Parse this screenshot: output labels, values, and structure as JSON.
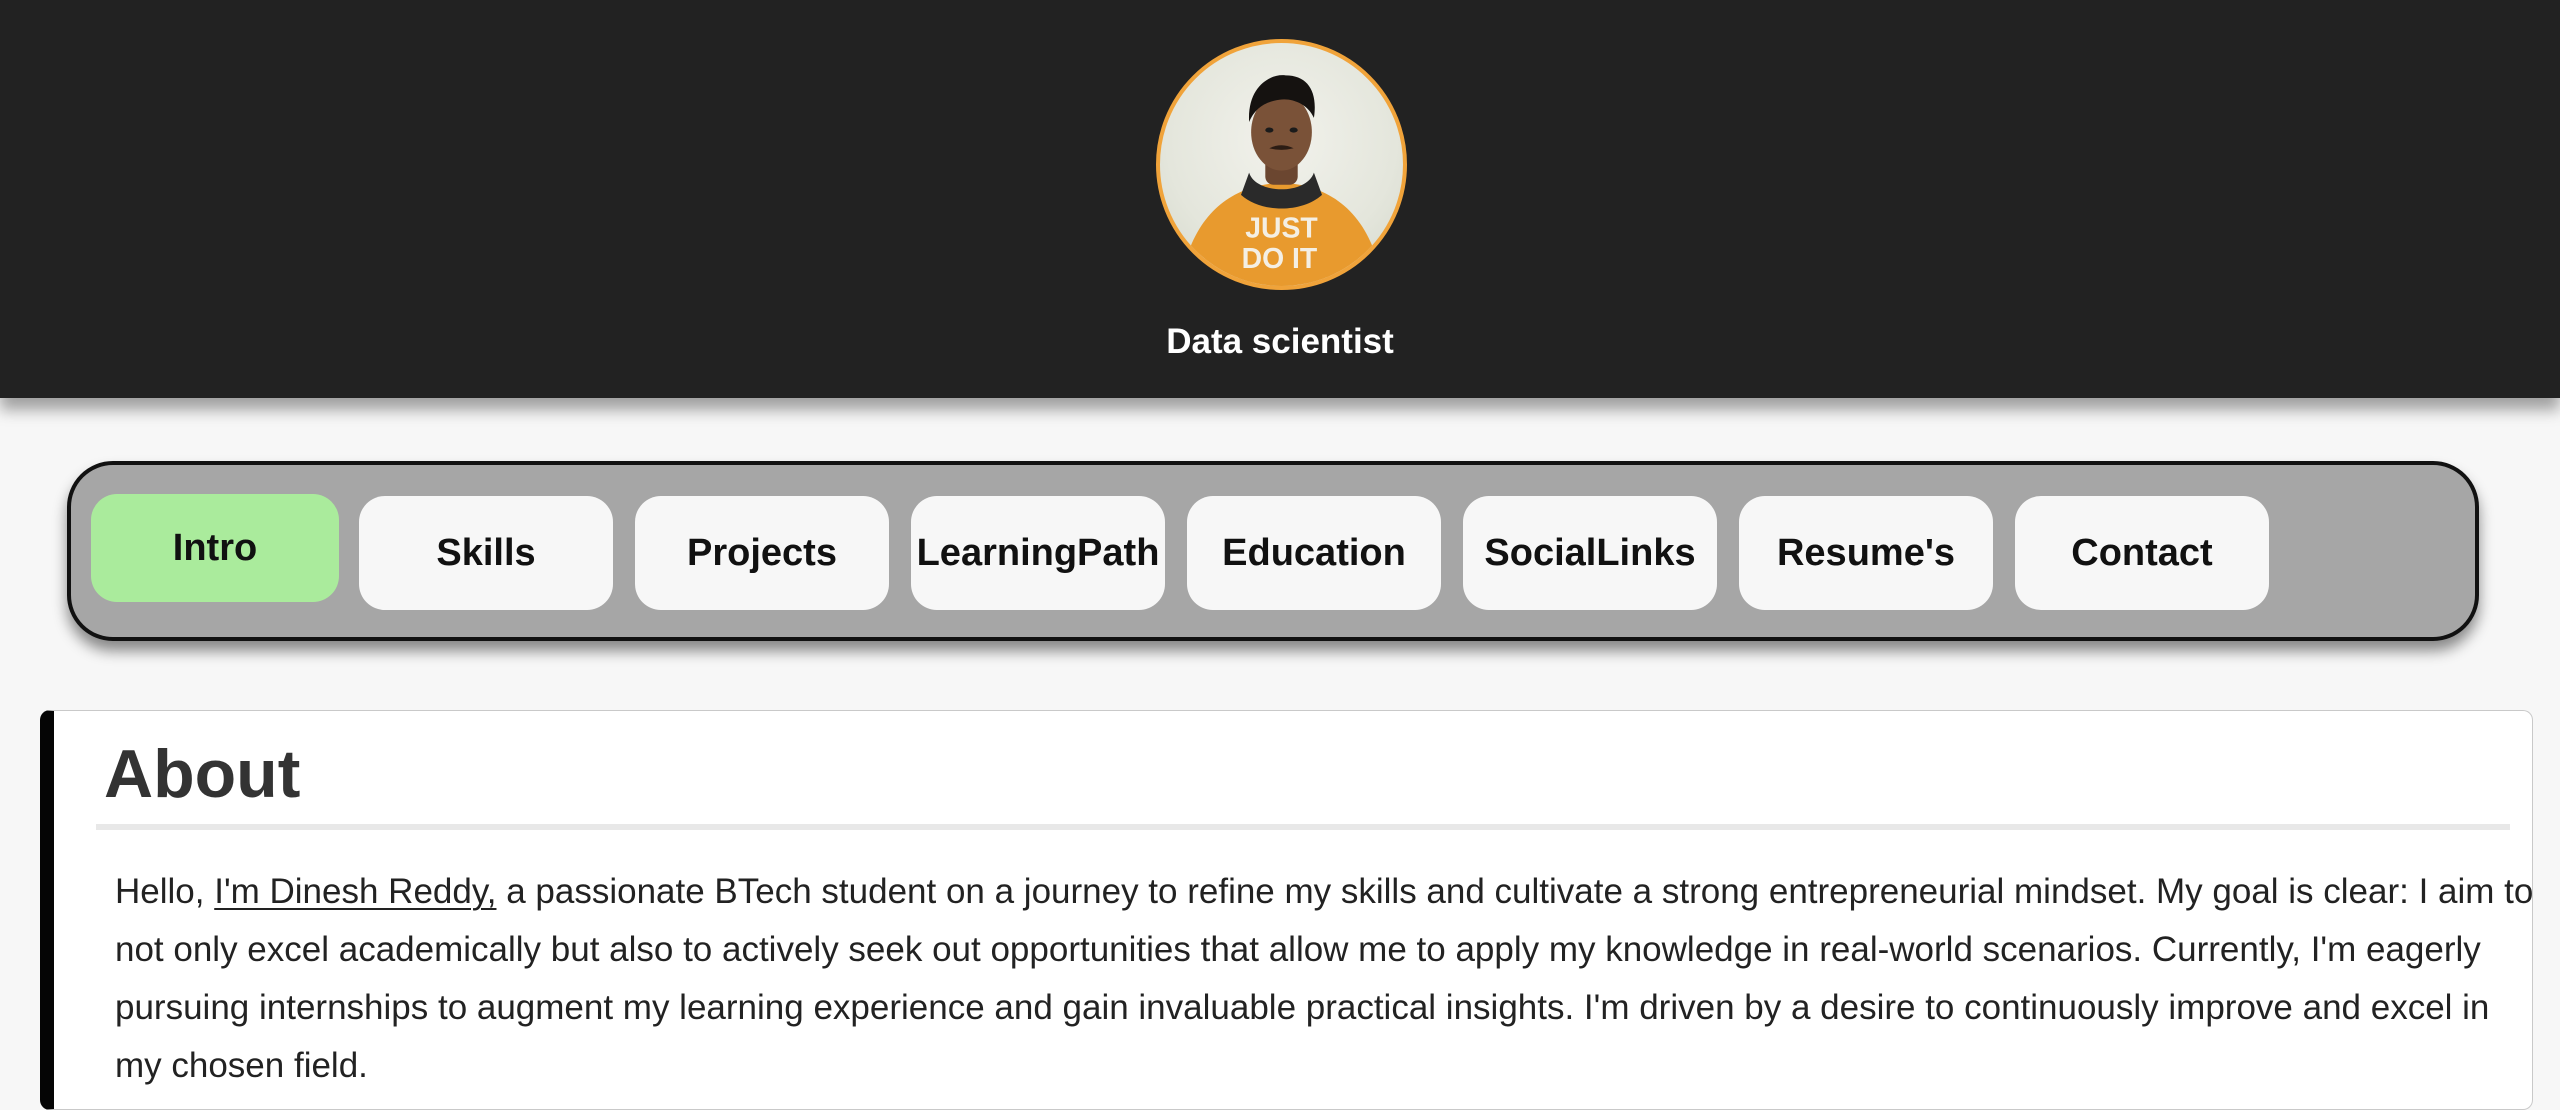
{
  "header": {
    "role": "Data scientist",
    "avatar_shirt_text_line1": "JUST",
    "avatar_shirt_text_line2": "DO IT",
    "accent_color": "#f0a33a",
    "background_color": "#222222"
  },
  "nav": {
    "tabs": [
      {
        "label": "Intro",
        "active": true
      },
      {
        "label": "Skills",
        "active": false
      },
      {
        "label": "Projects",
        "active": false
      },
      {
        "label": "LearningPath",
        "active": false
      },
      {
        "label": "Education",
        "active": false
      },
      {
        "label": "SocialLinks",
        "active": false
      },
      {
        "label": "Resume's",
        "active": false
      },
      {
        "label": "Contact",
        "active": false
      }
    ],
    "active_color": "#aaeb9c",
    "bar_color": "#a6a6a6"
  },
  "about": {
    "title": "About",
    "text_before_name": "Hello, ",
    "name": "I'm Dinesh Reddy,",
    "text_after_name": " a passionate BTech student on a journey to refine my skills and cultivate a strong entrepreneurial mindset. My goal is clear: I aim to not only excel academically but also to actively seek out opportunities that allow me to apply my knowledge in real-world scenarios. Currently, I'm eagerly pursuing internships to augment my learning experience and gain invaluable practical insights. I'm driven by a desire to continuously improve and excel in my chosen field."
  }
}
